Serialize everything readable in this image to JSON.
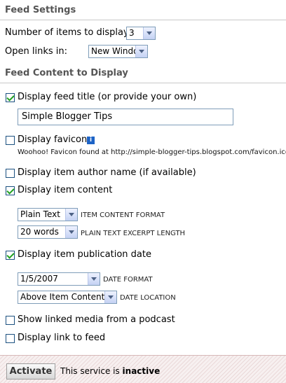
{
  "feed_settings": {
    "title": "Feed Settings",
    "items_label": "Number of items to display:",
    "items_value": "3",
    "open_links_label": "Open links in:",
    "open_links_value": "New Window"
  },
  "feed_content": {
    "title": "Feed Content to Display",
    "feed_title": {
      "label": "Display feed title (or provide your own)",
      "checked": true,
      "input_value": "Simple Blogger Tips"
    },
    "favicon": {
      "label": "Display favicon",
      "checked": false,
      "info_icon": "i",
      "note": "Woohoo! Favicon found at http://simple-blogger-tips.blogspot.com/favicon.ico"
    },
    "author": {
      "label": "Display item author name (if available)",
      "checked": false
    },
    "content": {
      "label": "Display item content",
      "checked": true,
      "format_value": "Plain Text",
      "format_label": "ITEM CONTENT FORMAT",
      "excerpt_value": "20 words",
      "excerpt_label": "PLAIN TEXT EXCERPT LENGTH"
    },
    "pubdate": {
      "label": "Display item publication date",
      "checked": true,
      "date_format_value": "1/5/2007",
      "date_format_label": "DATE FORMAT",
      "date_location_value": "Above Item Content",
      "date_location_label": "DATE LOCATION"
    },
    "podcast": {
      "label": "Show linked media from a podcast",
      "checked": false
    },
    "link_to_feed": {
      "label": "Display link to feed",
      "checked": false
    }
  },
  "footer": {
    "activate_label": "Activate",
    "status_prefix": "This service is",
    "status_value": "inactive"
  }
}
